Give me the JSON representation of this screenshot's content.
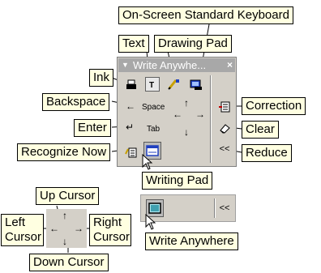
{
  "labels": {
    "onscreen_keyboard": "On-Screen Standard Keyboard",
    "text": "Text",
    "drawing_pad": "Drawing Pad",
    "ink": "Ink",
    "backspace": "Backspace",
    "enter": "Enter",
    "recognize_now": "Recognize Now",
    "correction": "Correction",
    "clear": "Clear",
    "reduce": "Reduce",
    "writing_pad": "Writing Pad",
    "up_cursor": "Up Cursor",
    "left_cursor": "Left Cursor",
    "right_cursor": "Right Cursor",
    "down_cursor": "Down Cursor",
    "write_anywhere": "Write Anywhere"
  },
  "panel": {
    "title": "Write Anywhe...",
    "space": "Space",
    "tab": "Tab",
    "reduce_glyph": "<<",
    "close_glyph": "×",
    "menu_glyph": "▼"
  },
  "panel2": {
    "reduce_glyph": "<<"
  },
  "icons": [
    "ink-icon",
    "text-icon",
    "drawing-pad-icon",
    "keyboard-icon",
    "correction-icon",
    "clear-icon",
    "recognize-now-icon",
    "writing-pad-icon",
    "write-anywhere-icon",
    "mouse-pointer-icon"
  ]
}
